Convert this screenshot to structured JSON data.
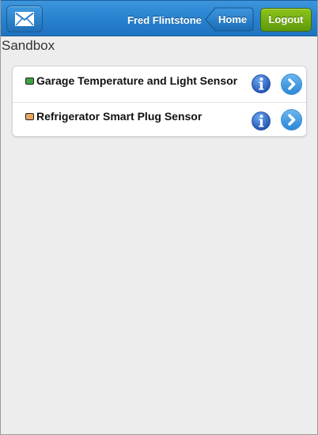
{
  "header": {
    "mail_icon": "envelope-icon",
    "user_name": "Fred Flintstone",
    "home_label": "Home",
    "logout_label": "Logout"
  },
  "page": {
    "title": "Sandbox"
  },
  "sensors": [
    {
      "label": "Garage Temperature and Light Sensor",
      "status_color": "#3fa43f",
      "info_icon": "info-icon",
      "detail_icon": "chevron-right-icon"
    },
    {
      "label": "Refrigerator Smart Plug Sensor",
      "status_color": "#e8a560",
      "info_icon": "info-icon",
      "detail_icon": "chevron-right-icon"
    }
  ],
  "colors": {
    "header_blue": "#2a84d1",
    "logout_green": "#6fae12",
    "background": "#ededed"
  }
}
